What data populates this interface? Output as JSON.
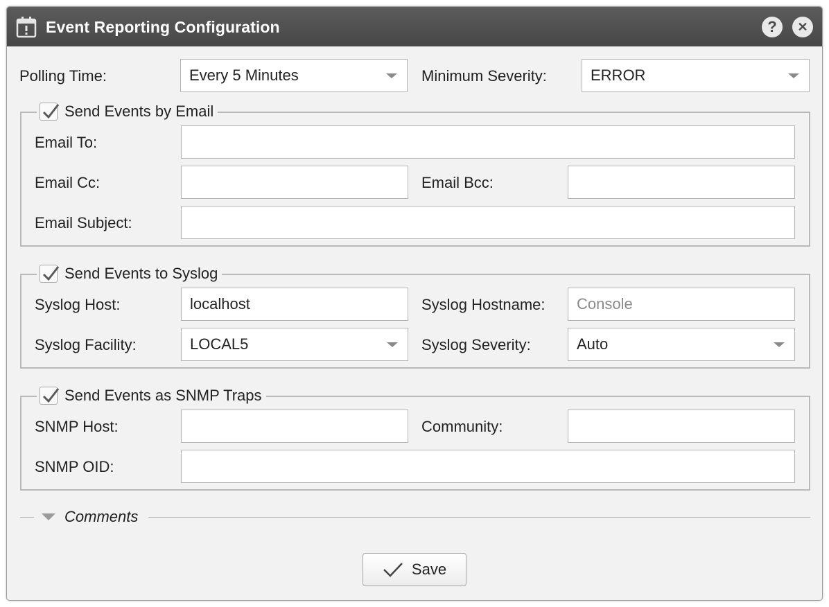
{
  "window": {
    "title": "Event Reporting Configuration"
  },
  "titlebar": {
    "help_icon": "?",
    "close_icon": "✕"
  },
  "top": {
    "polling_time_label": "Polling Time:",
    "polling_time_value": "Every 5 Minutes",
    "min_severity_label": "Minimum Severity:",
    "min_severity_value": "ERROR"
  },
  "email": {
    "legend": "Send Events by Email",
    "checked": true,
    "to_label": "Email To:",
    "to_value": "",
    "cc_label": "Email Cc:",
    "cc_value": "",
    "bcc_label": "Email Bcc:",
    "bcc_value": "",
    "subject_label": "Email Subject:",
    "subject_value": ""
  },
  "syslog": {
    "legend": "Send Events to Syslog",
    "checked": true,
    "host_label": "Syslog Host:",
    "host_value": "localhost",
    "hostname_label": "Syslog Hostname:",
    "hostname_placeholder": "Console",
    "facility_label": "Syslog Facility:",
    "facility_value": "LOCAL5",
    "severity_label": "Syslog Severity:",
    "severity_value": "Auto"
  },
  "snmp": {
    "legend": "Send Events as SNMP Traps",
    "checked": true,
    "host_label": "SNMP Host:",
    "host_value": "",
    "community_label": "Community:",
    "community_value": "",
    "oid_label": "SNMP OID:",
    "oid_value": ""
  },
  "comments": {
    "label": "Comments"
  },
  "footer": {
    "save_label": "Save"
  },
  "colors": {
    "titlebar": "#4d4d4d",
    "background": "#f2f2f2",
    "border": "#b9b9b9"
  }
}
